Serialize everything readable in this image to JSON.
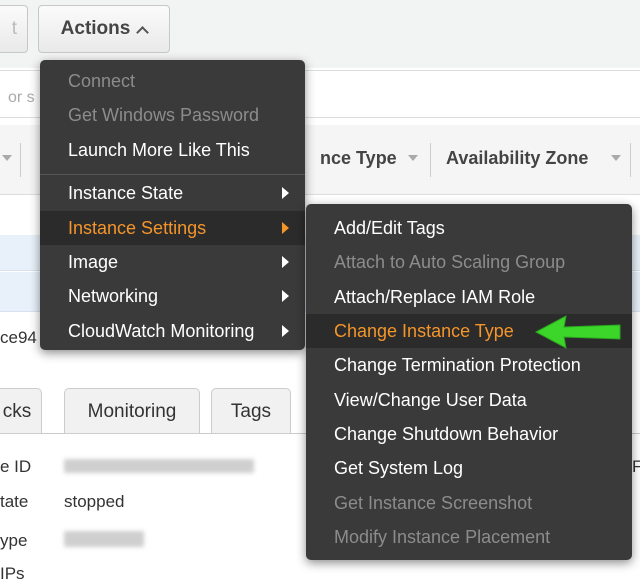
{
  "toolbar": {
    "left_button_label": "t",
    "actions_label": "Actions"
  },
  "search": {
    "partial_text": "or s"
  },
  "columns": {
    "instance_type": "nce Type",
    "availability_zone": "Availability Zone"
  },
  "instance_row": {
    "id_fragment": "ce94"
  },
  "tabs": [
    {
      "label": "cks"
    },
    {
      "label": "Monitoring"
    },
    {
      "label": "Tags"
    }
  ],
  "details": {
    "labels": [
      "e ID",
      "tate",
      "ype",
      "IPs"
    ],
    "state_value": "stopped",
    "edge_char": "F"
  },
  "actions_menu": {
    "items": [
      {
        "label": "Connect",
        "enabled": false,
        "submenu": false
      },
      {
        "label": "Get Windows Password",
        "enabled": false,
        "submenu": false
      },
      {
        "label": "Launch More Like This",
        "enabled": true,
        "submenu": false
      },
      {
        "label": "Instance State",
        "enabled": true,
        "submenu": true
      },
      {
        "label": "Instance Settings",
        "enabled": true,
        "submenu": true,
        "highlighted": true
      },
      {
        "label": "Image",
        "enabled": true,
        "submenu": true
      },
      {
        "label": "Networking",
        "enabled": true,
        "submenu": true
      },
      {
        "label": "CloudWatch Monitoring",
        "enabled": true,
        "submenu": true
      }
    ]
  },
  "instance_settings_menu": {
    "items": [
      {
        "label": "Add/Edit Tags",
        "enabled": true
      },
      {
        "label": "Attach to Auto Scaling Group",
        "enabled": false
      },
      {
        "label": "Attach/Replace IAM Role",
        "enabled": true
      },
      {
        "label": "Change Instance Type",
        "enabled": true,
        "highlighted": true
      },
      {
        "label": "Change Termination Protection",
        "enabled": true
      },
      {
        "label": "View/Change User Data",
        "enabled": true
      },
      {
        "label": "Change Shutdown Behavior",
        "enabled": true
      },
      {
        "label": "Get System Log",
        "enabled": true
      },
      {
        "label": "Get Instance Screenshot",
        "enabled": false
      },
      {
        "label": "Modify Instance Placement",
        "enabled": false
      }
    ]
  },
  "colors": {
    "menu_bg": "#3a3a3a",
    "highlight_text": "#f4952a",
    "disabled_text": "#8c8c8c",
    "annotation_arrow": "#3cd62b"
  }
}
